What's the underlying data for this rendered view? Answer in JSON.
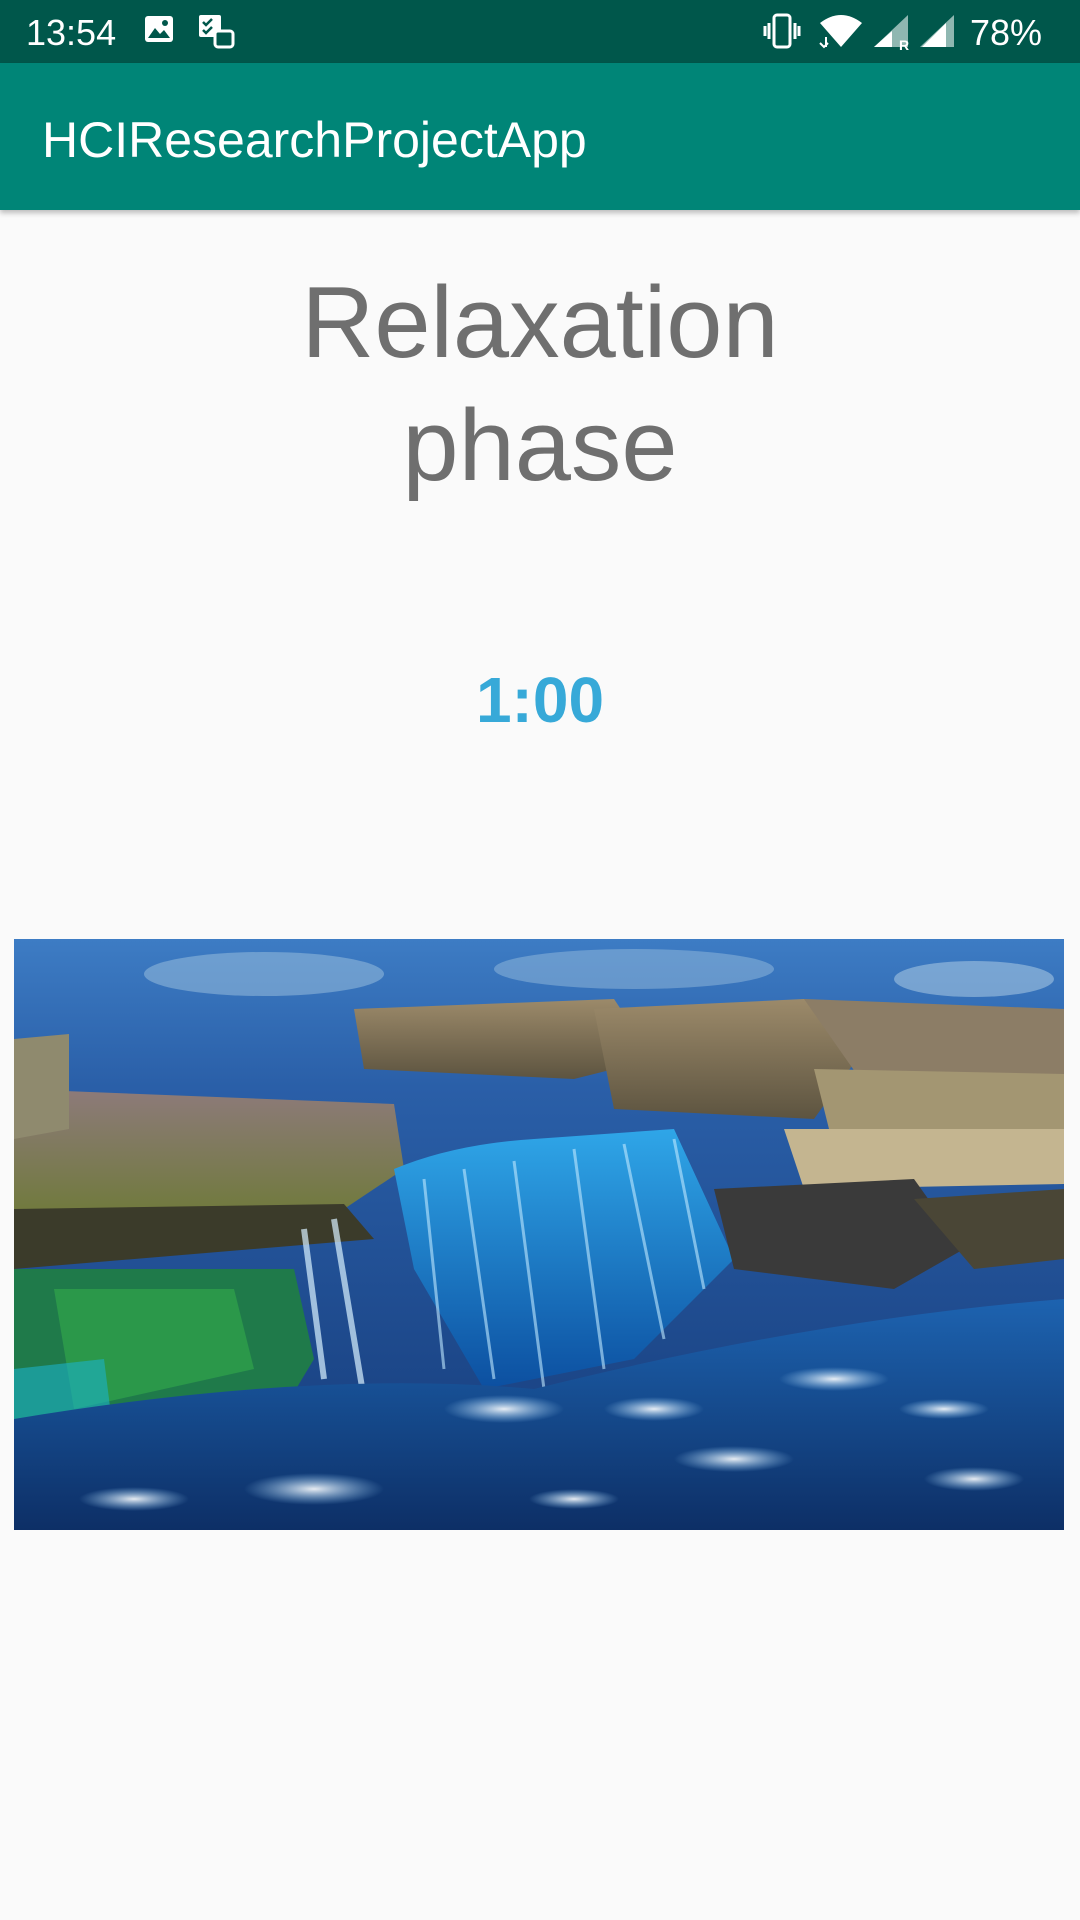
{
  "status_bar": {
    "time": "13:54",
    "battery": "78%",
    "icons": [
      "image-icon",
      "task-icon",
      "vibrate-icon",
      "wifi-icon",
      "signal-roaming-icon",
      "signal-icon"
    ]
  },
  "app_bar": {
    "title": "HCIResearchProjectApp"
  },
  "main": {
    "title_line1": "Relaxation",
    "title_line2": "phase",
    "timer": "1:00",
    "media": "waterfall-image"
  },
  "colors": {
    "status_bar": "#00574b",
    "app_bar": "#008577",
    "timer": "#37a9d8",
    "title_text": "#6f6f6f",
    "background": "#fafafa"
  }
}
